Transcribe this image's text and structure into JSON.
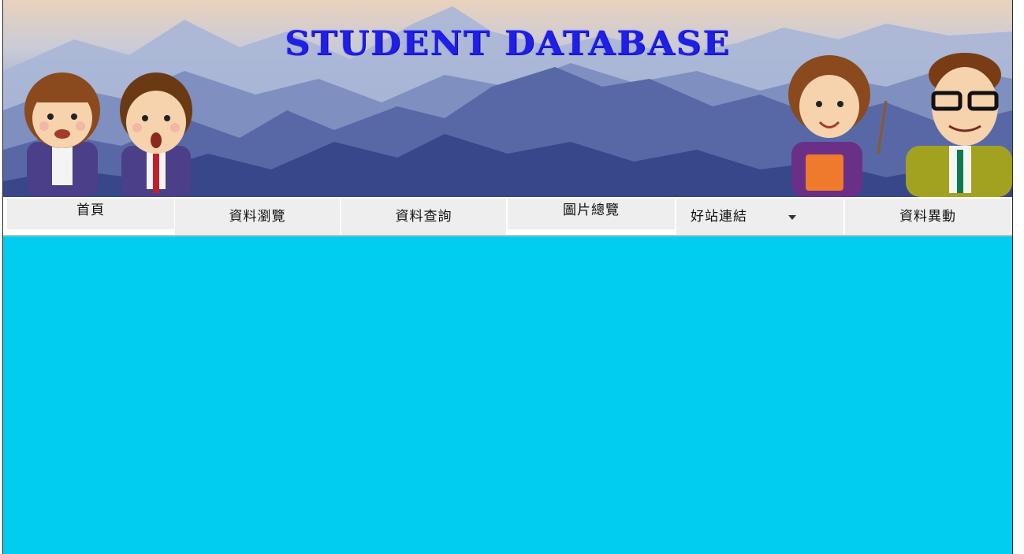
{
  "site": {
    "title": "STUDENT DATABASE"
  },
  "nav": {
    "items": [
      {
        "label": "首頁"
      },
      {
        "label": "資料瀏覽"
      },
      {
        "label": "資料查詢"
      },
      {
        "label": "圖片總覽"
      },
      {
        "label": "好站連結"
      },
      {
        "label": "資料異動"
      }
    ]
  },
  "colors": {
    "title": "#1f1fe6",
    "nav_bg": "#eeeeee",
    "content_bg": "#00cdef"
  },
  "icons": {
    "dropdown": "chevron-down-icon"
  }
}
